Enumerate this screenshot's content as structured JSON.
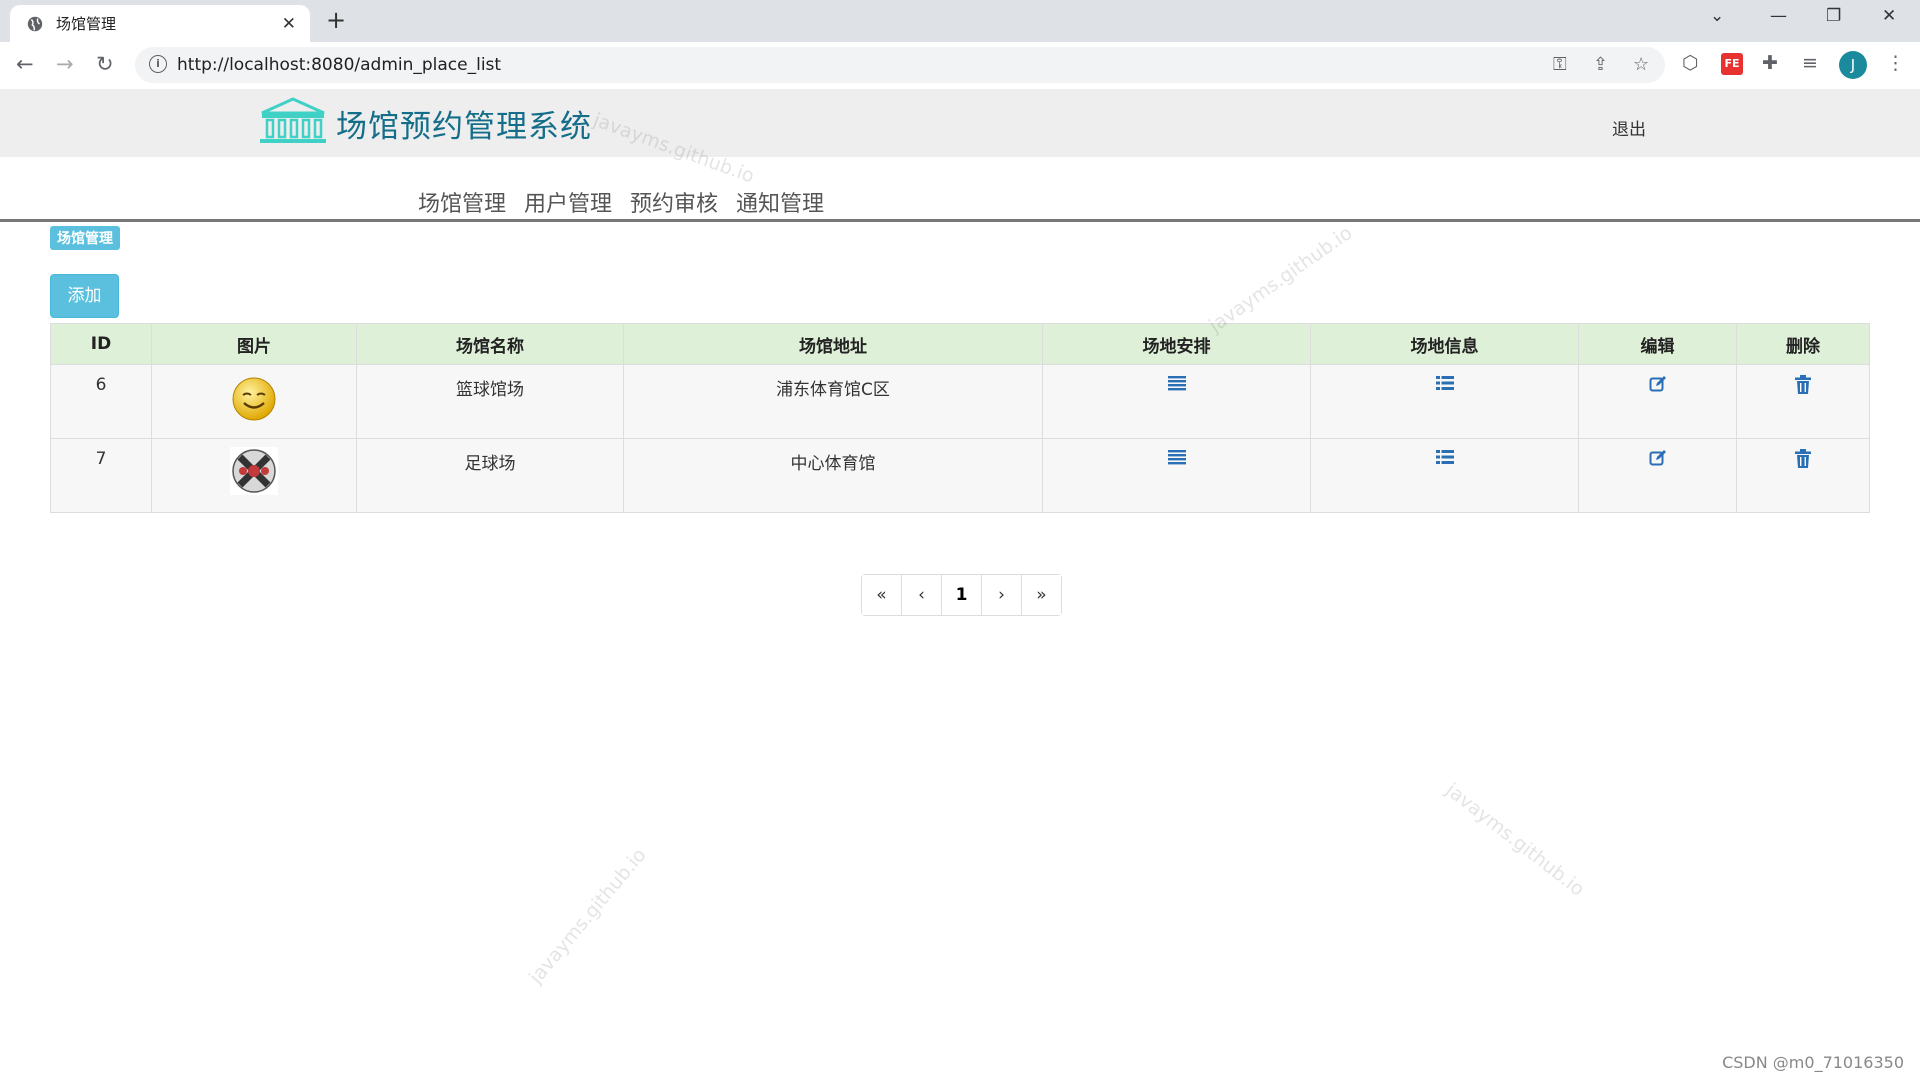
{
  "browser": {
    "tab_title": "场馆管理",
    "url": "http://localhost:8080/admin_place_list",
    "avatar_letter": "J",
    "ext_fe_label": "FE"
  },
  "header": {
    "site_title": "场馆预约管理系统",
    "logout": "退出"
  },
  "nav": [
    "场馆管理",
    "用户管理",
    "预约审核",
    "通知管理"
  ],
  "breadcrumb": "场馆管理",
  "add_button": "添加",
  "table": {
    "headers": [
      "ID",
      "图片",
      "场馆名称",
      "场馆地址",
      "场地安排",
      "场地信息",
      "编辑",
      "删除"
    ],
    "rows": [
      {
        "id": "6",
        "image": "smiley-face",
        "name": "篮球馆场",
        "address": "浦东体育馆C区"
      },
      {
        "id": "7",
        "image": "soccer-ball",
        "name": "足球场",
        "address": "中心体育馆"
      }
    ]
  },
  "pagination": {
    "first": "«",
    "prev": "‹",
    "current": "1",
    "next": "›",
    "last": "»"
  },
  "watermark": "javayms.github.io",
  "csdn": "CSDN @m0_71016350",
  "colors": {
    "accent": "#5bc0de",
    "table_header": "#dff0d8",
    "icon": "#2a6fb5",
    "title": "#146e8a"
  }
}
